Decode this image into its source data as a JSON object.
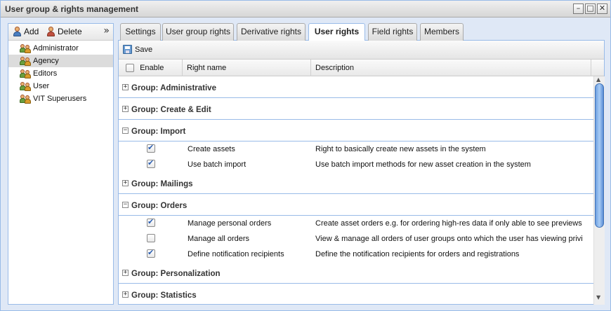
{
  "window": {
    "title": "User group & rights management"
  },
  "left_toolbar": {
    "add_label": "Add",
    "delete_label": "Delete",
    "collapse_glyph": "»"
  },
  "user_groups": [
    {
      "label": "Administrator"
    },
    {
      "label": "Agency",
      "selected": true
    },
    {
      "label": "Editors"
    },
    {
      "label": "User"
    },
    {
      "label": "VIT Superusers"
    }
  ],
  "tabs": [
    {
      "label": "Settings"
    },
    {
      "label": "User group rights"
    },
    {
      "label": "Derivative rights"
    },
    {
      "label": "User rights",
      "active": true
    },
    {
      "label": "Field rights"
    },
    {
      "label": "Members"
    }
  ],
  "toolbar": {
    "save_label": "Save"
  },
  "grid": {
    "headers": {
      "enable": "Enable",
      "right_name": "Right name",
      "description": "Description"
    },
    "groups": [
      {
        "title": "Group: Administrative",
        "expanded": false,
        "rows": []
      },
      {
        "title": "Group: Create & Edit",
        "expanded": false,
        "rows": []
      },
      {
        "title": "Group: Import",
        "expanded": true,
        "rows": [
          {
            "enabled": true,
            "name": "Create assets",
            "description": "Right to basically create new assets in the system"
          },
          {
            "enabled": true,
            "name": "Use batch import",
            "description": "Use batch import methods for new asset creation in the system"
          }
        ]
      },
      {
        "title": "Group: Mailings",
        "expanded": false,
        "rows": []
      },
      {
        "title": "Group: Orders",
        "expanded": true,
        "rows": [
          {
            "enabled": true,
            "name": "Manage personal orders",
            "description": "Create asset orders e.g. for ordering high-res data if only able to see previews"
          },
          {
            "enabled": false,
            "name": "Manage all orders",
            "description": "View & manage all orders of user groups onto which the user has viewing privi"
          },
          {
            "enabled": true,
            "name": "Define notification recipients",
            "description": "Define the notification recipients for orders and registrations"
          }
        ]
      },
      {
        "title": "Group: Personalization",
        "expanded": false,
        "rows": []
      },
      {
        "title": "Group: Statistics",
        "expanded": false,
        "rows": []
      }
    ]
  }
}
